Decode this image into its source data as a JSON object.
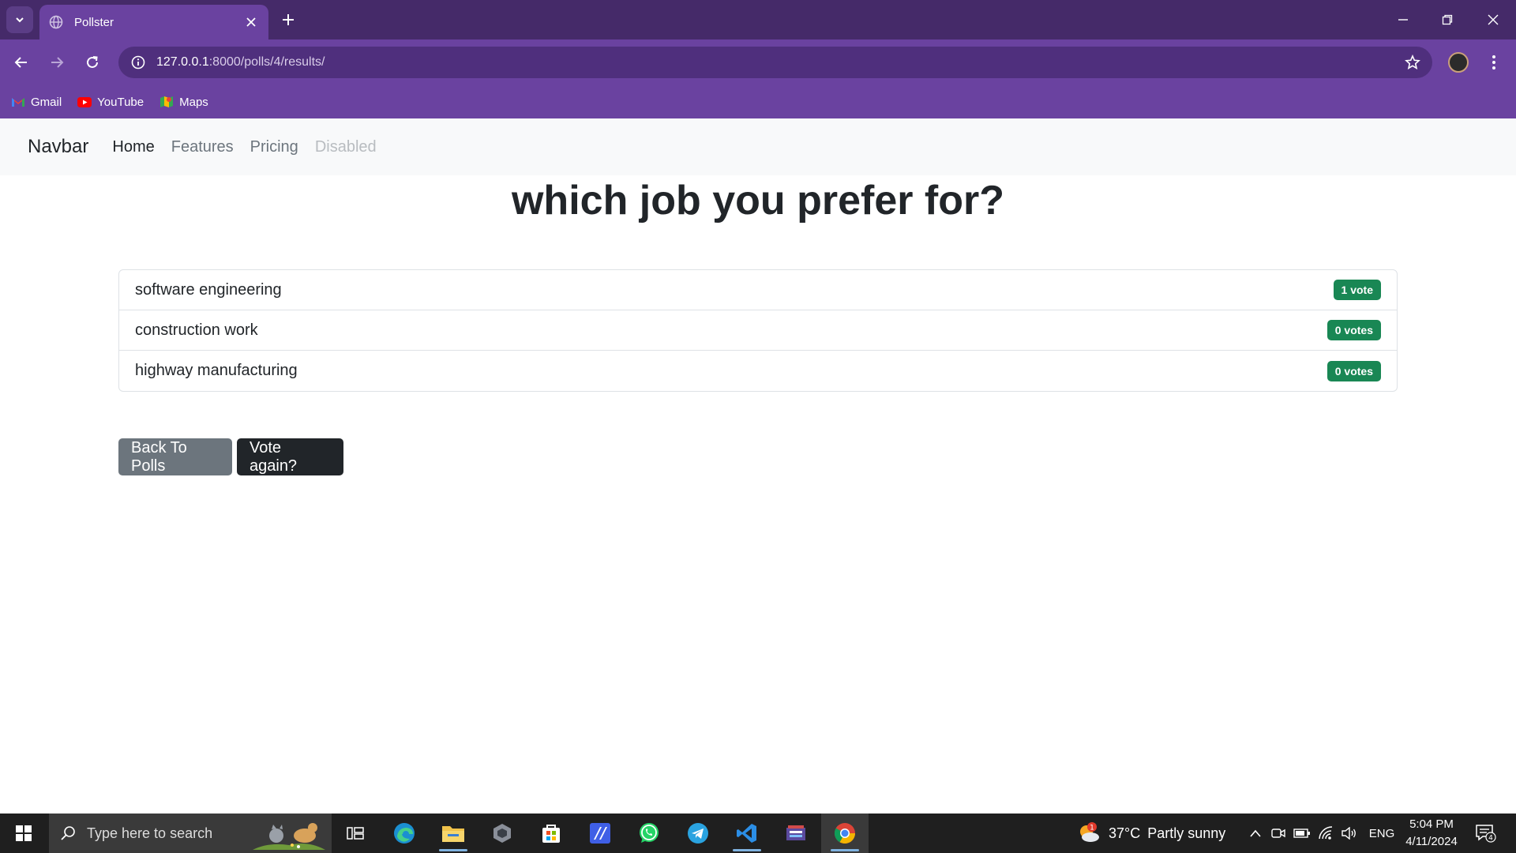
{
  "browser": {
    "tab_title": "Pollster",
    "url_host": "127.0.0.1",
    "url_path": ":8000/polls/4/results/",
    "bookmarks": [
      {
        "label": "Gmail",
        "icon": "gmail-icon"
      },
      {
        "label": "YouTube",
        "icon": "youtube-icon"
      },
      {
        "label": "Maps",
        "icon": "maps-icon"
      }
    ],
    "accent_color": "#6a42a0"
  },
  "navbar": {
    "brand": "Navbar",
    "links": [
      {
        "label": "Home",
        "state": "active"
      },
      {
        "label": "Features",
        "state": "normal"
      },
      {
        "label": "Pricing",
        "state": "normal"
      },
      {
        "label": "Disabled",
        "state": "disabled"
      }
    ]
  },
  "poll": {
    "question": "which job you prefer for?",
    "results": [
      {
        "choice": "software engineering",
        "votes": "1 vote"
      },
      {
        "choice": "construction work",
        "votes": "0 votes"
      },
      {
        "choice": "highway manufacturing",
        "votes": "0 votes"
      }
    ],
    "badge_color": "#198754",
    "back_label": "Back To Polls",
    "vote_again_label": "Vote again?"
  },
  "taskbar": {
    "search_placeholder": "Type here to search",
    "weather_temp": "37°C",
    "weather_desc": "Partly sunny",
    "weather_alert_count": "1",
    "language": "ENG",
    "time": "5:04 PM",
    "date": "4/11/2024",
    "notification_count": "4"
  }
}
